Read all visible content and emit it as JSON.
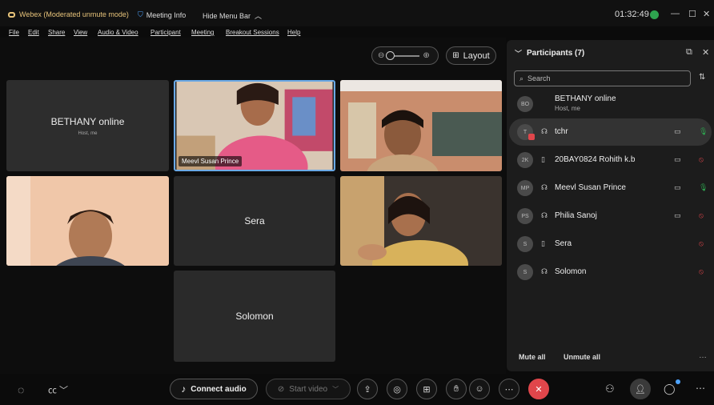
{
  "titlebar": {
    "app_title": "Webex (Moderated unmute mode)",
    "meeting_info": "Meeting Info",
    "hide_menu_bar": "Hide Menu Bar",
    "time": "01:32:49"
  },
  "menu": [
    "File",
    "Edit",
    "Share",
    "View",
    "Audio & Video",
    "Participant",
    "Meeting",
    "Breakout Sessions",
    "Help"
  ],
  "layout_button": "Layout",
  "tiles": {
    "bethany": {
      "name": "BETHANY online",
      "sub": "Host, me"
    },
    "meevl": {
      "nametag": "Meevl Susan Prince"
    },
    "sera": {
      "name": "Sera"
    },
    "solomon": {
      "name": "Solomon"
    }
  },
  "participants": {
    "title": "Participants (7)",
    "search_placeholder": "Search",
    "list": [
      {
        "initials": "BO",
        "name": "BETHANY online",
        "sub": "Host, me",
        "device": "",
        "video": false,
        "mic": "none"
      },
      {
        "initials": "T",
        "name": "tchr",
        "sub": "",
        "device": "headset",
        "video": true,
        "mic": "on"
      },
      {
        "initials": "2K",
        "name": "20BAY0824 Rohith k.b",
        "sub": "",
        "device": "mobile",
        "video": true,
        "mic": "muted"
      },
      {
        "initials": "MP",
        "name": "Meevl Susan Prince",
        "sub": "",
        "device": "headset",
        "video": true,
        "mic": "on"
      },
      {
        "initials": "PS",
        "name": "Philia Sanoj",
        "sub": "",
        "device": "headset",
        "video": true,
        "mic": "muted"
      },
      {
        "initials": "S",
        "name": "Sera",
        "sub": "",
        "device": "mobile",
        "video": false,
        "mic": "muted"
      },
      {
        "initials": "S",
        "name": "Solomon",
        "sub": "",
        "device": "headset",
        "video": false,
        "mic": "muted"
      }
    ],
    "mute_all": "Mute all",
    "unmute_all": "Unmute all"
  },
  "bottom": {
    "connect_audio": "Connect audio",
    "start_video": "Start video"
  },
  "colors": {
    "mic_on": "#2ea44f",
    "mic_muted": "#e0464b",
    "end_call": "#e0464b"
  }
}
